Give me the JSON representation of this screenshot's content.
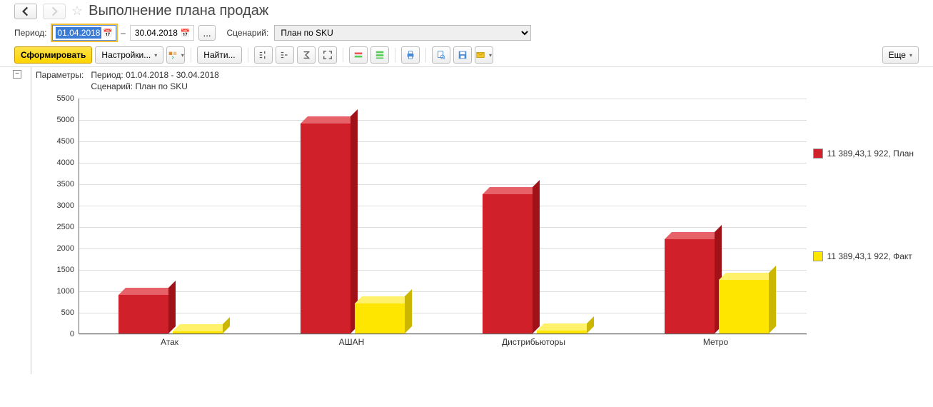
{
  "header": {
    "title": "Выполнение плана продаж"
  },
  "period": {
    "label": "Период:",
    "from": "01.04.2018",
    "sep": "–",
    "to": "30.04.2018"
  },
  "scenario": {
    "label": "Сценарий:",
    "value": "План по SKU"
  },
  "toolbar": {
    "form": "Сформировать",
    "settings": "Настройки...",
    "find": "Найти...",
    "more": "Еще"
  },
  "params_box": {
    "label": "Параметры:",
    "line1": "Период: 01.04.2018 - 30.04.2018",
    "line2": "Сценарий: План по SKU"
  },
  "legend": {
    "plan": "11 389,43,1 922, План",
    "fact": "11 389,43,1 922, Факт"
  },
  "chart_data": {
    "type": "bar",
    "ylim": [
      0,
      5500
    ],
    "yticks": [
      0,
      500,
      1000,
      1500,
      2000,
      2500,
      3000,
      3500,
      4000,
      4500,
      5000,
      5500
    ],
    "categories": [
      "Атак",
      "АШАН",
      "Дистрибьюторы",
      "Метро"
    ],
    "series": [
      {
        "name": "План",
        "values": [
          900,
          4900,
          3250,
          2200
        ]
      },
      {
        "name": "Факт",
        "values": [
          50,
          700,
          60,
          1250
        ]
      }
    ]
  }
}
